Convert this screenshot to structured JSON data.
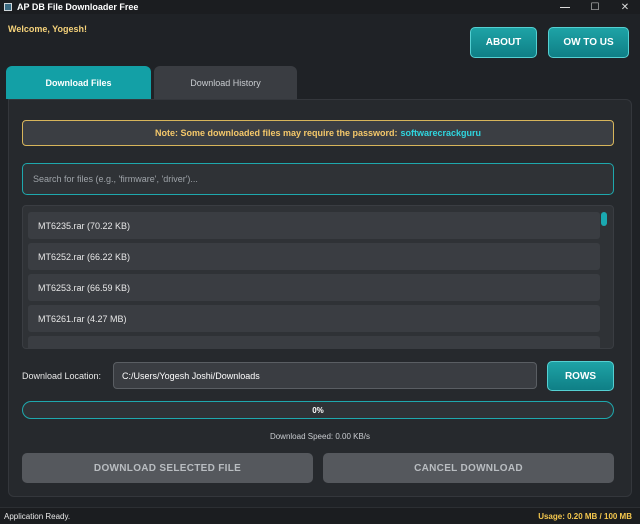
{
  "window": {
    "title": "AP DB File Downloader Free",
    "minimize": "—",
    "maximize": "☐",
    "close": "✕"
  },
  "header": {
    "welcome": "Welcome, Yogesh!",
    "about_label": "ABOUT",
    "howto_label": "OW TO US"
  },
  "tabs": [
    {
      "label": "Download Files",
      "active": true
    },
    {
      "label": "Download History",
      "active": false
    }
  ],
  "note": {
    "text": "Note: Some downloaded files may require the password:",
    "password": "softwarecrackguru"
  },
  "search": {
    "placeholder": "Search for files (e.g., 'firmware', 'driver')...",
    "value": ""
  },
  "files": [
    {
      "label": "MT6235.rar (70.22 KB)"
    },
    {
      "label": "MT6252.rar (66.22 KB)"
    },
    {
      "label": "MT6253.rar (66.59 KB)"
    },
    {
      "label": "MT6261.rar (4.27 MB)"
    }
  ],
  "location": {
    "label": "Download Location:",
    "value": "C:/Users/Yogesh Joshi/Downloads",
    "browse_label": "ROWS"
  },
  "progress": {
    "percent": 0,
    "text": "0%"
  },
  "speed": "Download Speed: 0.00 KB/s",
  "actions": {
    "download_label": "DOWNLOAD SELECTED FILE",
    "cancel_label": "CANCEL DOWNLOAD"
  },
  "status": {
    "left": "Application Ready.",
    "usage": "Usage: 0.20 MB / 100 MB"
  },
  "colors": {
    "accent": "#13a0a6",
    "warning": "#f5c86a",
    "password": "#2fd6e0",
    "background": "#1f2226"
  }
}
